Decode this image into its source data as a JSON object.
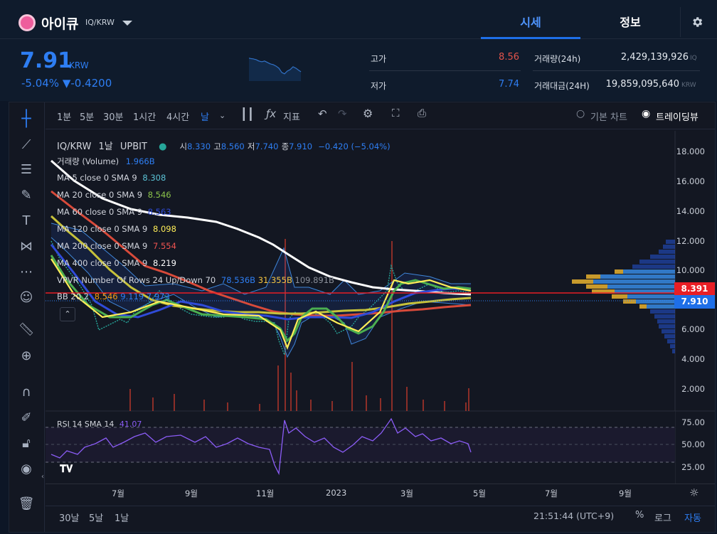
{
  "header": {
    "coin_name": "아이큐",
    "coin_pair": "IQ/KRW",
    "tabs": [
      {
        "label": "시세"
      },
      {
        "label": "정보"
      }
    ]
  },
  "ticker": {
    "price": "7.91",
    "price_unit": "KRW",
    "change": "-5.04% ▼-0.4200",
    "high_label": "고가",
    "high_value": "8.56",
    "low_label": "저가",
    "low_value": "7.74",
    "volume_label": "거래량(24h)",
    "volume_value": "2,429,139,926",
    "volume_unit": "IQ",
    "amount_label": "거래대금(24H)",
    "amount_value": "19,859,095,640",
    "amount_unit": "KRW"
  },
  "toolbar": {
    "intervals": [
      "1분",
      "5분",
      "30분",
      "1시간",
      "4시간",
      "날"
    ],
    "indicator_label": "지표",
    "basic_chart_label": "기본 차트",
    "trading_view_label": "트레이딩뷰"
  },
  "legend": {
    "symbol": "IQ/KRW",
    "interval": "1날",
    "exchange": "UPBIT",
    "ohlc_open_label": "시",
    "ohlc_open": "8.330",
    "ohlc_high_label": "고",
    "ohlc_high": "8.560",
    "ohlc_low_label": "저",
    "ohlc_low": "7.740",
    "ohlc_close_label": "종",
    "ohlc_close": "7.910",
    "ohlc_change": "−0.420 (−5.04%)",
    "volume_label": "거래량 (Volume)",
    "volume_value": "1.966B",
    "ma5_label": "MA 5 close 0 SMA 9",
    "ma5_value": "8.308",
    "ma20_label": "MA 20 close 0 SMA 9",
    "ma20_value": "8.546",
    "ma60_label": "MA 60 close 0 SMA 9",
    "ma60_value": "8.563",
    "ma120_label": "MA 120 close 0 SMA 9",
    "ma120_value": "8.098",
    "ma200_label": "MA 200 close 0 SMA 9",
    "ma200_value": "7.554",
    "ma400_label": "MA 400 close 0 SMA 9",
    "ma400_value": "8.219",
    "vpvr_label": "VPVR Number Of Rows 24 Up/Down 70",
    "vpvr_v1": "78.536B",
    "vpvr_v2": "31.355B",
    "vpvr_v3": "109.891B",
    "bb_label": "BB 20 2",
    "bb_v1": "8.546",
    "bb_v2": "9.119",
    "bb_v3": "7.973",
    "rsi_label": "RSI 14 SMA 14",
    "rsi_value": "41.07"
  },
  "price_axis": [
    "18.000",
    "16.000",
    "14.000",
    "12.000",
    "10.000",
    "8.391",
    "7.910",
    "6.000",
    "4.000",
    "2.000"
  ],
  "rsi_axis": [
    "75.00",
    "50.00",
    "25.00"
  ],
  "time_axis": [
    "7월",
    "9월",
    "11월",
    "2023",
    "3월",
    "5월",
    "7월",
    "9월"
  ],
  "bottom": {
    "ranges": [
      "30날",
      "5날",
      "1날"
    ],
    "clock": "21:51:44 (UTC+9)",
    "percent": "%",
    "log": "로그",
    "auto": "자동"
  },
  "colors": {
    "accent": "#1e6fe8",
    "price_blue": "#2e7ef3",
    "high_red": "#e2534b",
    "current_price_red": "#e81e25"
  },
  "chart_data": {
    "type": "line",
    "y_range": [
      0,
      19
    ],
    "rsi_range": [
      0,
      100
    ],
    "current_price": 7.91,
    "reference_price": 8.391
  }
}
